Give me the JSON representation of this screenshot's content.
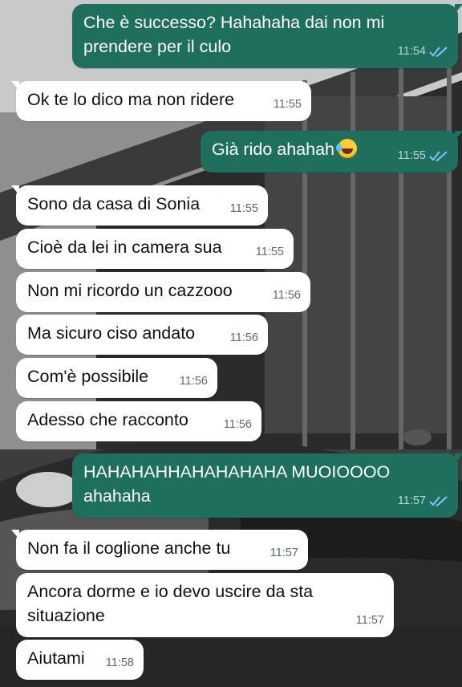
{
  "colors": {
    "outgoing_bubble": "#1f6f5f",
    "incoming_bubble": "#ffffff",
    "read_ticks": "#7ec3ff"
  },
  "messages": [
    {
      "dir": "out",
      "text": "Che è successo? Hahahaha dai non mi prendere per il culo",
      "time": "11:54",
      "ticks": "double-check-read-icon"
    },
    {
      "dir": "in",
      "text": "Ok te lo dico ma non ridere",
      "time": "11:55"
    },
    {
      "dir": "out",
      "text": "Già rido ahahah",
      "time": "11:55",
      "emoji": "rolling-on-floor-laughing-emoji",
      "ticks": "double-check-read-icon"
    },
    {
      "dir": "in",
      "text": "Sono da casa di Sonia",
      "time": "11:55"
    },
    {
      "dir": "in",
      "text": "Cioè da lei in camera sua",
      "time": "11:55"
    },
    {
      "dir": "in",
      "text": "Non mi ricordo un cazzooo",
      "time": "11:56"
    },
    {
      "dir": "in",
      "text": "Ma sicuro ciso andato",
      "time": "11:56"
    },
    {
      "dir": "in",
      "text": "Com'è possibile",
      "time": "11:56"
    },
    {
      "dir": "in",
      "text": "Adesso che racconto",
      "time": "11:56"
    },
    {
      "dir": "out",
      "text": "HAHAHAHHAHAHAHAHA MUOIOOOO ahahaha",
      "time": "11:57",
      "ticks": "double-check-read-icon"
    },
    {
      "dir": "in",
      "text": "Non fa il coglione anche tu",
      "time": "11:57"
    },
    {
      "dir": "in",
      "text": "Ancora dorme e io devo uscire da sta situazione",
      "time": "11:57"
    },
    {
      "dir": "in",
      "text": "Aiutami",
      "time": "11:58"
    }
  ]
}
